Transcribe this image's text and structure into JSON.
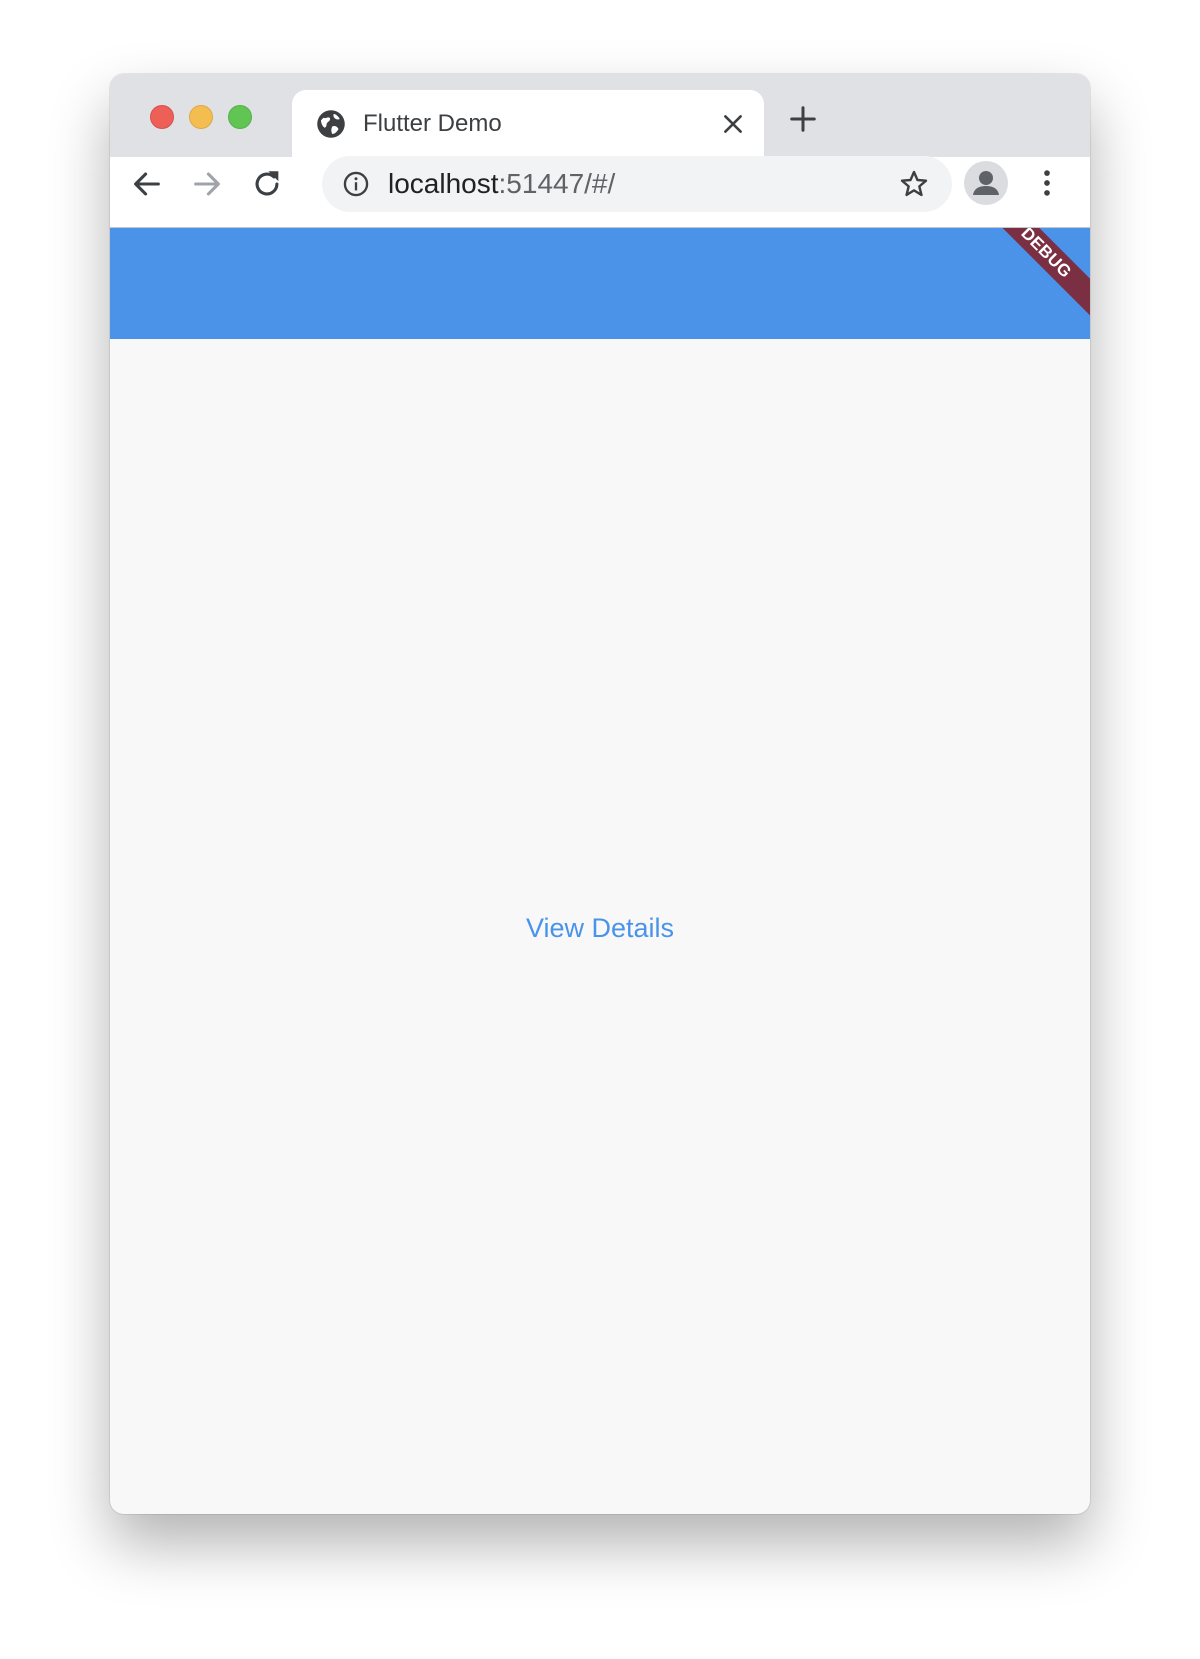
{
  "browser": {
    "tab": {
      "title": "Flutter Demo",
      "icon": "globe-icon"
    },
    "address_bar": {
      "host": "localhost",
      "rest": ":51447/#/"
    }
  },
  "app": {
    "debug_banner": "DEBUG",
    "body": {
      "link_label": "View Details"
    }
  },
  "colors": {
    "appbar": "#4a93e9",
    "link": "#4a93e9",
    "debug_banner": "#7a2f43"
  }
}
